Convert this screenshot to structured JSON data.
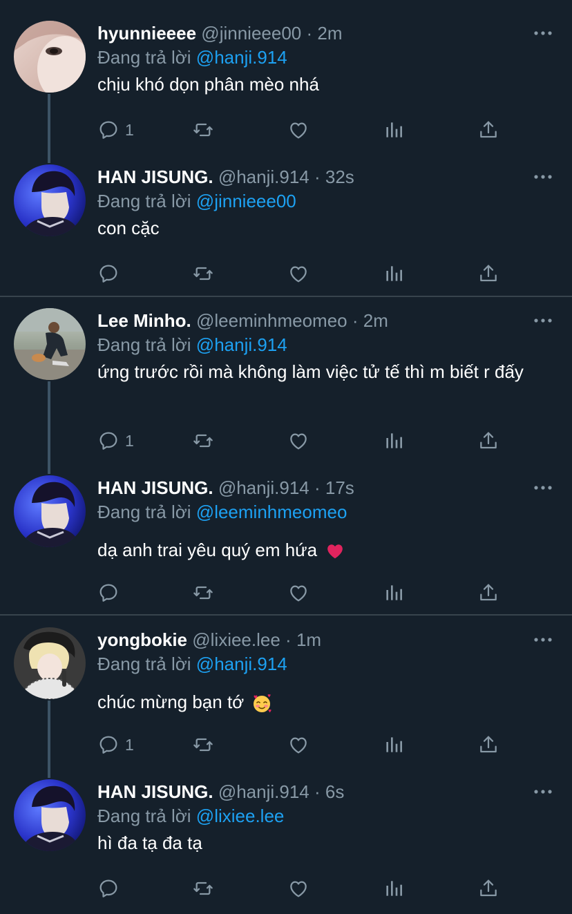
{
  "tweets": [
    {
      "name": "hyunnieeee",
      "handle": "@jinnieee00",
      "time": "2m",
      "reply_prefix": "Đang trả lời",
      "mention": "@hanji.914",
      "text": "chịu khó dọn phân mèo nhá",
      "reply_count": "1",
      "avatar_icon": "avatar-hyunnieeee"
    },
    {
      "name": "HAN JISUNG.",
      "handle": "@hanji.914",
      "time": "32s",
      "reply_prefix": "Đang trả lời",
      "mention": "@jinnieee00",
      "text": "con cặc",
      "reply_count": "",
      "avatar_icon": "avatar-han-jisung"
    },
    {
      "name": "Lee Minho.",
      "handle": "@leeminhmeomeo",
      "time": "2m",
      "reply_prefix": "Đang trả lời",
      "mention": "@hanji.914",
      "text": "ứng trước rồi mà không làm việc tử tế thì m biết r đấy",
      "reply_count": "1",
      "avatar_icon": "avatar-lee-minho"
    },
    {
      "name": "HAN JISUNG.",
      "handle": "@hanji.914",
      "time": "17s",
      "reply_prefix": "Đang trả lời",
      "mention": "@leeminhmeomeo",
      "text": "dạ anh trai yêu quý em hứa",
      "reply_count": "",
      "avatar_icon": "avatar-han-jisung",
      "emoji": "red-heart"
    },
    {
      "name": "yongbokie",
      "handle": "@lixiee.lee",
      "time": "1m",
      "reply_prefix": "Đang trả lời",
      "mention": "@hanji.914",
      "text": "chúc mừng bạn tớ",
      "reply_count": "1",
      "avatar_icon": "avatar-yongbokie",
      "emoji": "smiling-face-with-hearts"
    },
    {
      "name": "HAN JISUNG.",
      "handle": "@hanji.914",
      "time": "6s",
      "reply_prefix": "Đang trả lời",
      "mention": "@lixiee.lee",
      "text": "hì đa tạ đa tạ",
      "reply_count": "",
      "avatar_icon": "avatar-han-jisung"
    }
  ],
  "separator": "·",
  "colors": {
    "background": "#15202b",
    "secondary_text": "#8899a6",
    "link": "#1da1f2",
    "divider": "#38444d"
  },
  "action_icons": [
    "reply-icon",
    "retweet-icon",
    "like-icon",
    "analytics-icon",
    "share-icon"
  ]
}
